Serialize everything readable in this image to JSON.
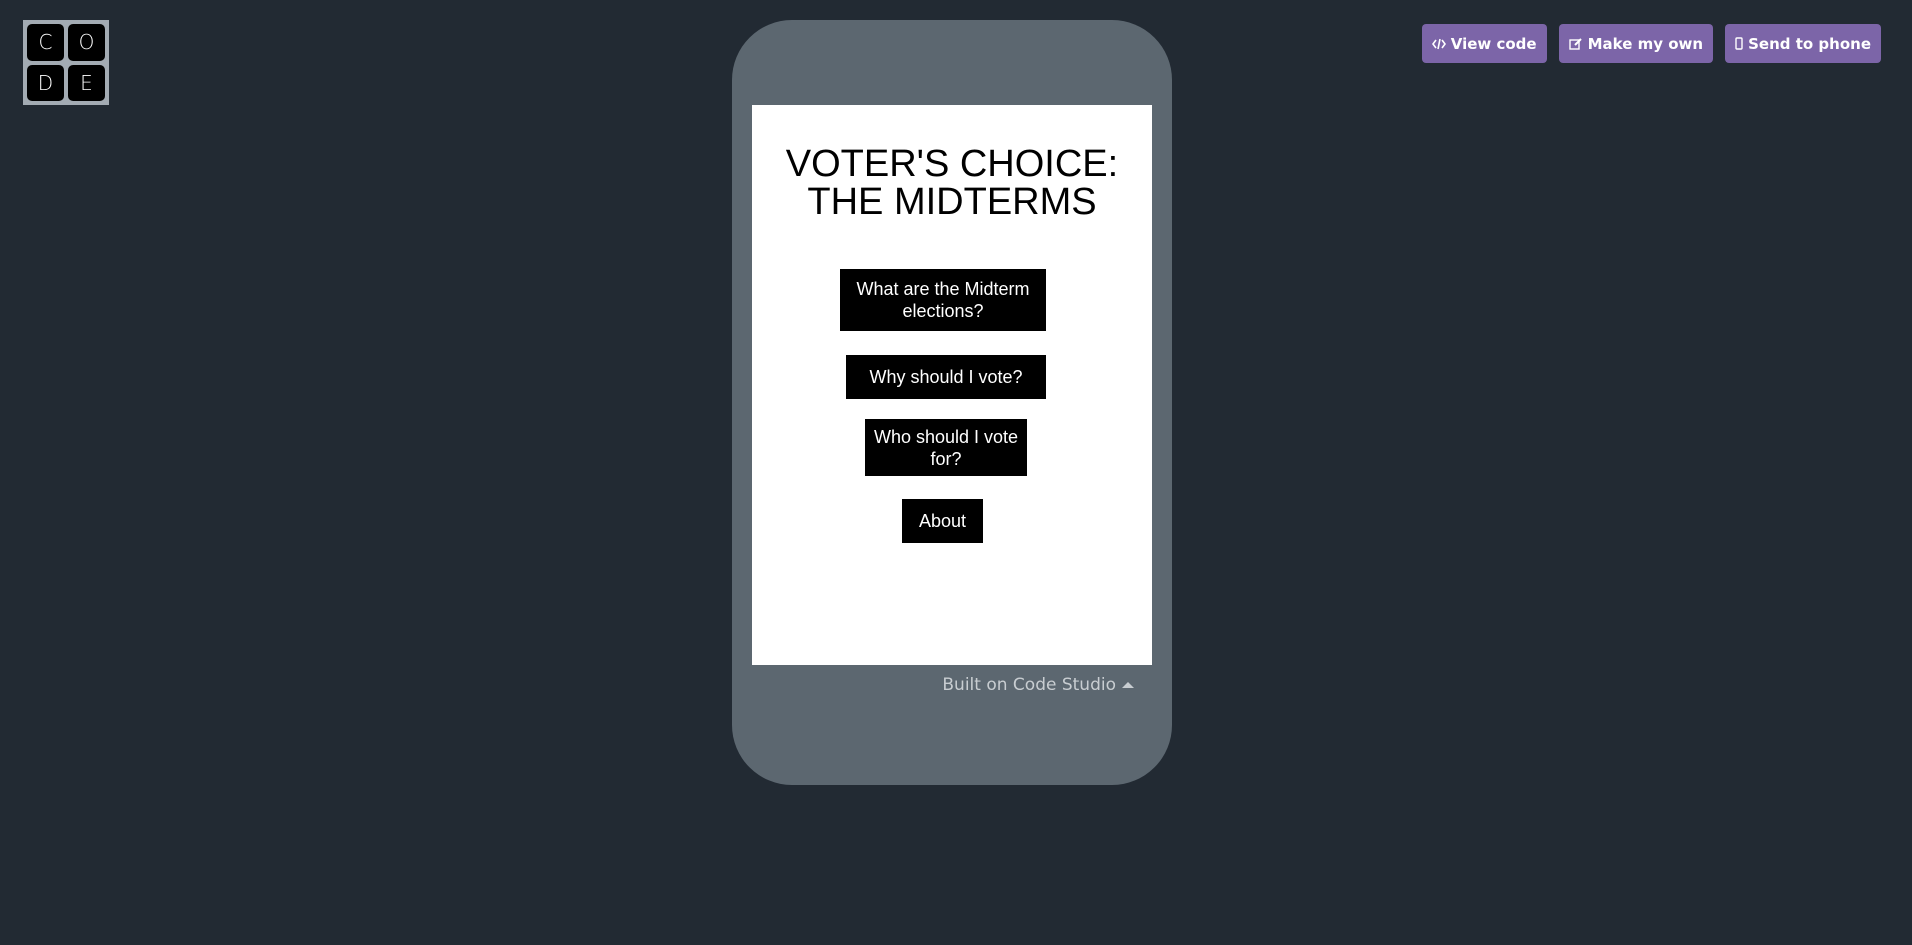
{
  "logo": {
    "letters": [
      "C",
      "O",
      "D",
      "E"
    ]
  },
  "actions": {
    "view_code": "View code",
    "make_my_own": "Make my own",
    "send_to_phone": "Send to phone"
  },
  "app": {
    "title_line1": "VOTER'S CHOICE:",
    "title_line2": "THE MIDTERMS",
    "buttons": [
      {
        "line1": "What are the  Midterm",
        "line2": "elections?"
      },
      {
        "line1": "Why should I vote?",
        "line2": ""
      },
      {
        "line1": "Who should I vote",
        "line2": "for?"
      },
      {
        "line1": "About",
        "line2": ""
      }
    ]
  },
  "footer": {
    "label": "Built on Code Studio"
  },
  "colors": {
    "background": "#222a33",
    "phone_frame": "#5c6770",
    "accent_button": "#7c65a8"
  }
}
